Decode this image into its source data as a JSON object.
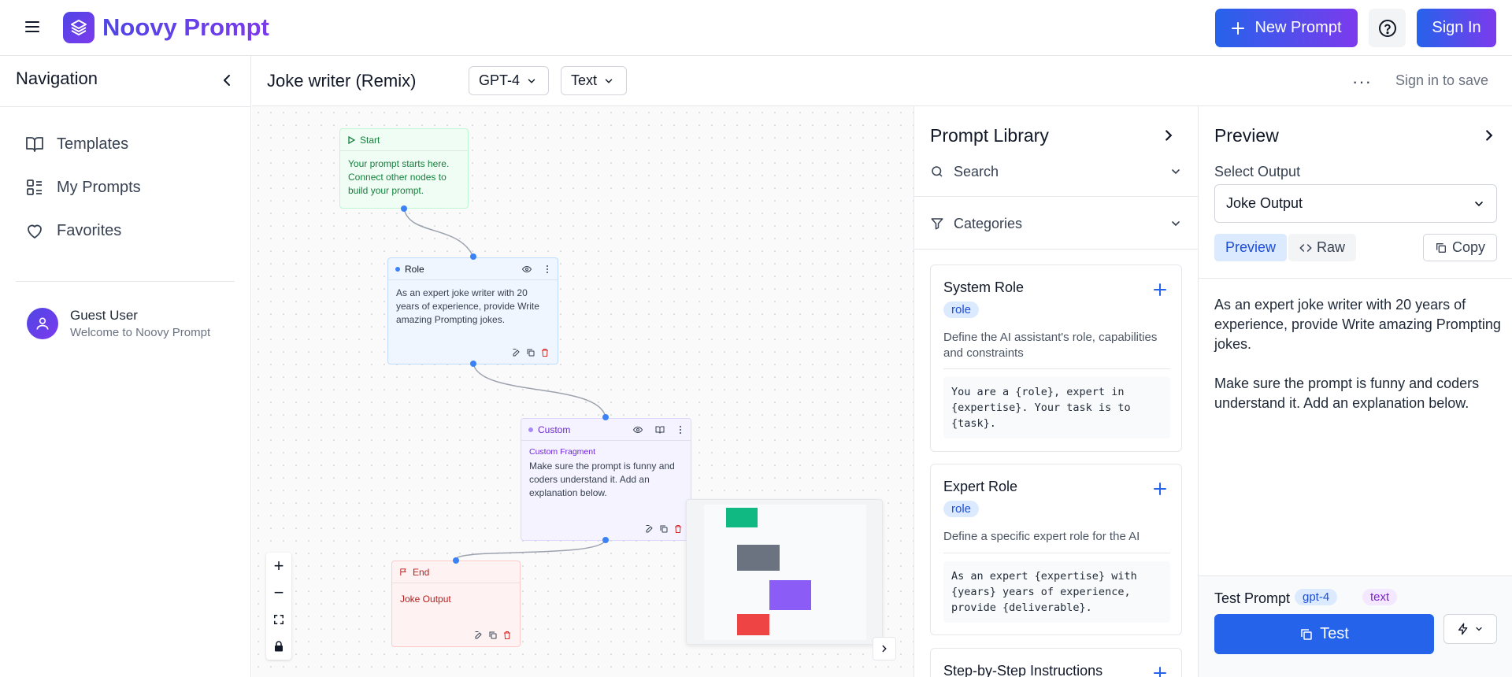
{
  "app": {
    "name": "Noovy Prompt"
  },
  "header": {
    "new_prompt_label": "New Prompt",
    "sign_in_label": "Sign In"
  },
  "sidebar": {
    "title": "Navigation",
    "items": [
      {
        "label": "Templates",
        "icon": "book-icon"
      },
      {
        "label": "My Prompts",
        "icon": "list-icon"
      },
      {
        "label": "Favorites",
        "icon": "heart-icon"
      }
    ],
    "user": {
      "name": "Guest User",
      "subtitle": "Welcome to Noovy Prompt"
    }
  },
  "editor": {
    "prompt_title": "Joke writer (Remix)",
    "model": "GPT-4",
    "format": "Text",
    "more_label": "···",
    "save_label": "Sign in to save"
  },
  "canvas": {
    "nodes": {
      "start": {
        "title": "Start",
        "body": "Your prompt starts here. Connect other nodes to build your prompt."
      },
      "role": {
        "title": "Role",
        "body": "As an expert joke writer with 20 years of experience, provide Write amazing Prompting jokes."
      },
      "custom": {
        "title": "Custom",
        "subtitle": "Custom Fragment",
        "body": "Make sure the prompt is funny and coders understand it. Add an explanation below."
      },
      "end": {
        "title": "End",
        "body": "Joke Output"
      }
    },
    "zoom_controls": {
      "zoom_in": "+",
      "zoom_out": "−"
    }
  },
  "library": {
    "title": "Prompt Library",
    "search_label": "Search",
    "categories_label": "Categories",
    "cards": [
      {
        "title": "System Role",
        "badge": "role",
        "description": "Define the AI assistant's role, capabilities and constraints",
        "code": "You are a {role}, expert in\n{expertise}. Your task is to\n{task}."
      },
      {
        "title": "Expert Role",
        "badge": "role",
        "description": "Define a specific expert role for the AI",
        "code": "As an expert {expertise} with\n{years} years of experience,\nprovide {deliverable}."
      },
      {
        "title": "Step-by-Step Instructions"
      }
    ]
  },
  "preview": {
    "title": "Preview",
    "select_label": "Select Output",
    "selected_output": "Joke Output",
    "tab_preview": "Preview",
    "tab_raw": "Raw",
    "copy_label": "Copy",
    "text_1": "As an expert joke writer with 20 years of experience, provide Write amazing Prompting jokes.",
    "text_2": "Make sure the prompt is funny and coders understand it. Add an explanation below.",
    "test_label": "Test Prompt",
    "tag_model": "gpt-4",
    "tag_format": "text",
    "test_button": "Test"
  },
  "colors": {
    "brand_start": "#4f46e5",
    "brand_end": "#7c3aed",
    "primary": "#2563eb",
    "start_node": "#16a34a",
    "role_node": "#3b82f6",
    "custom_node": "#8b5cf6",
    "end_node": "#dc2626"
  }
}
